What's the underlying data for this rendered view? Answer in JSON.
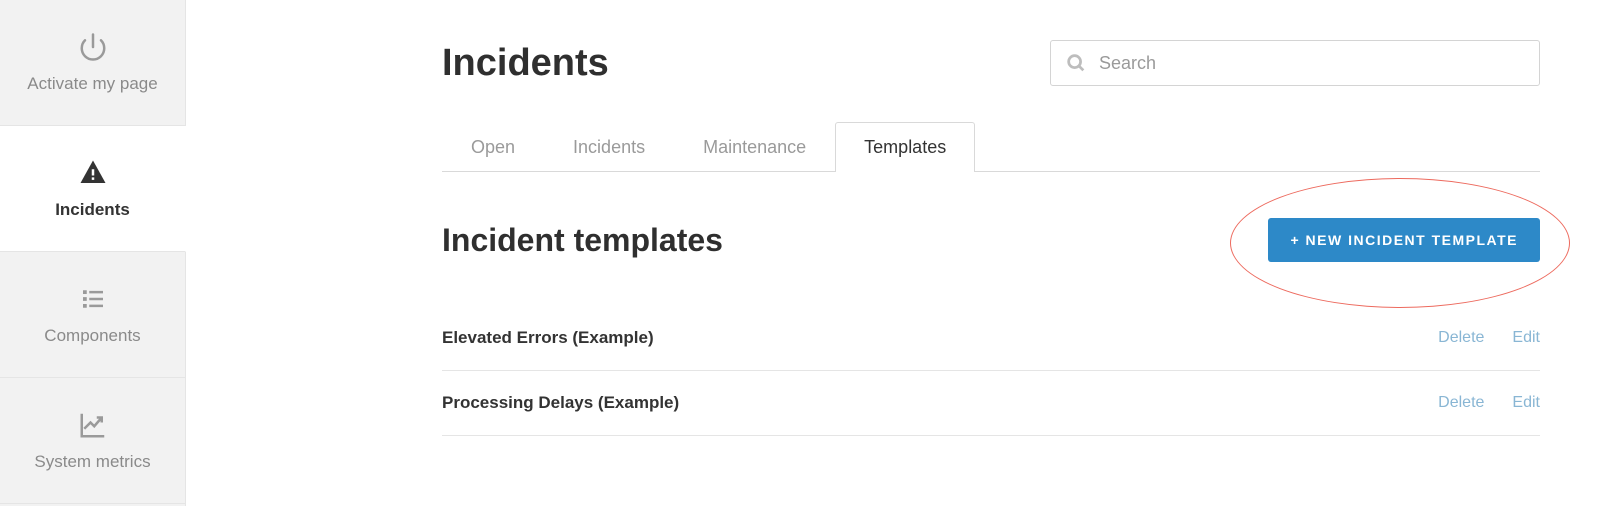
{
  "sidebar": {
    "items": [
      {
        "label": "Activate my page",
        "active": false
      },
      {
        "label": "Incidents",
        "active": true
      },
      {
        "label": "Components",
        "active": false
      },
      {
        "label": "System metrics",
        "active": false
      }
    ]
  },
  "header": {
    "title": "Incidents",
    "search_placeholder": "Search"
  },
  "tabs": [
    {
      "label": "Open",
      "active": false
    },
    {
      "label": "Incidents",
      "active": false
    },
    {
      "label": "Maintenance",
      "active": false
    },
    {
      "label": "Templates",
      "active": true
    }
  ],
  "section": {
    "title": "Incident templates",
    "new_button_label": "+ NEW INCIDENT TEMPLATE"
  },
  "templates": [
    {
      "name": "Elevated Errors (Example)",
      "delete_label": "Delete",
      "edit_label": "Edit"
    },
    {
      "name": "Processing Delays (Example)",
      "delete_label": "Delete",
      "edit_label": "Edit"
    }
  ],
  "colors": {
    "accent": "#2d89c8",
    "highlight": "#ed6a5e",
    "link": "#89b6d4"
  }
}
